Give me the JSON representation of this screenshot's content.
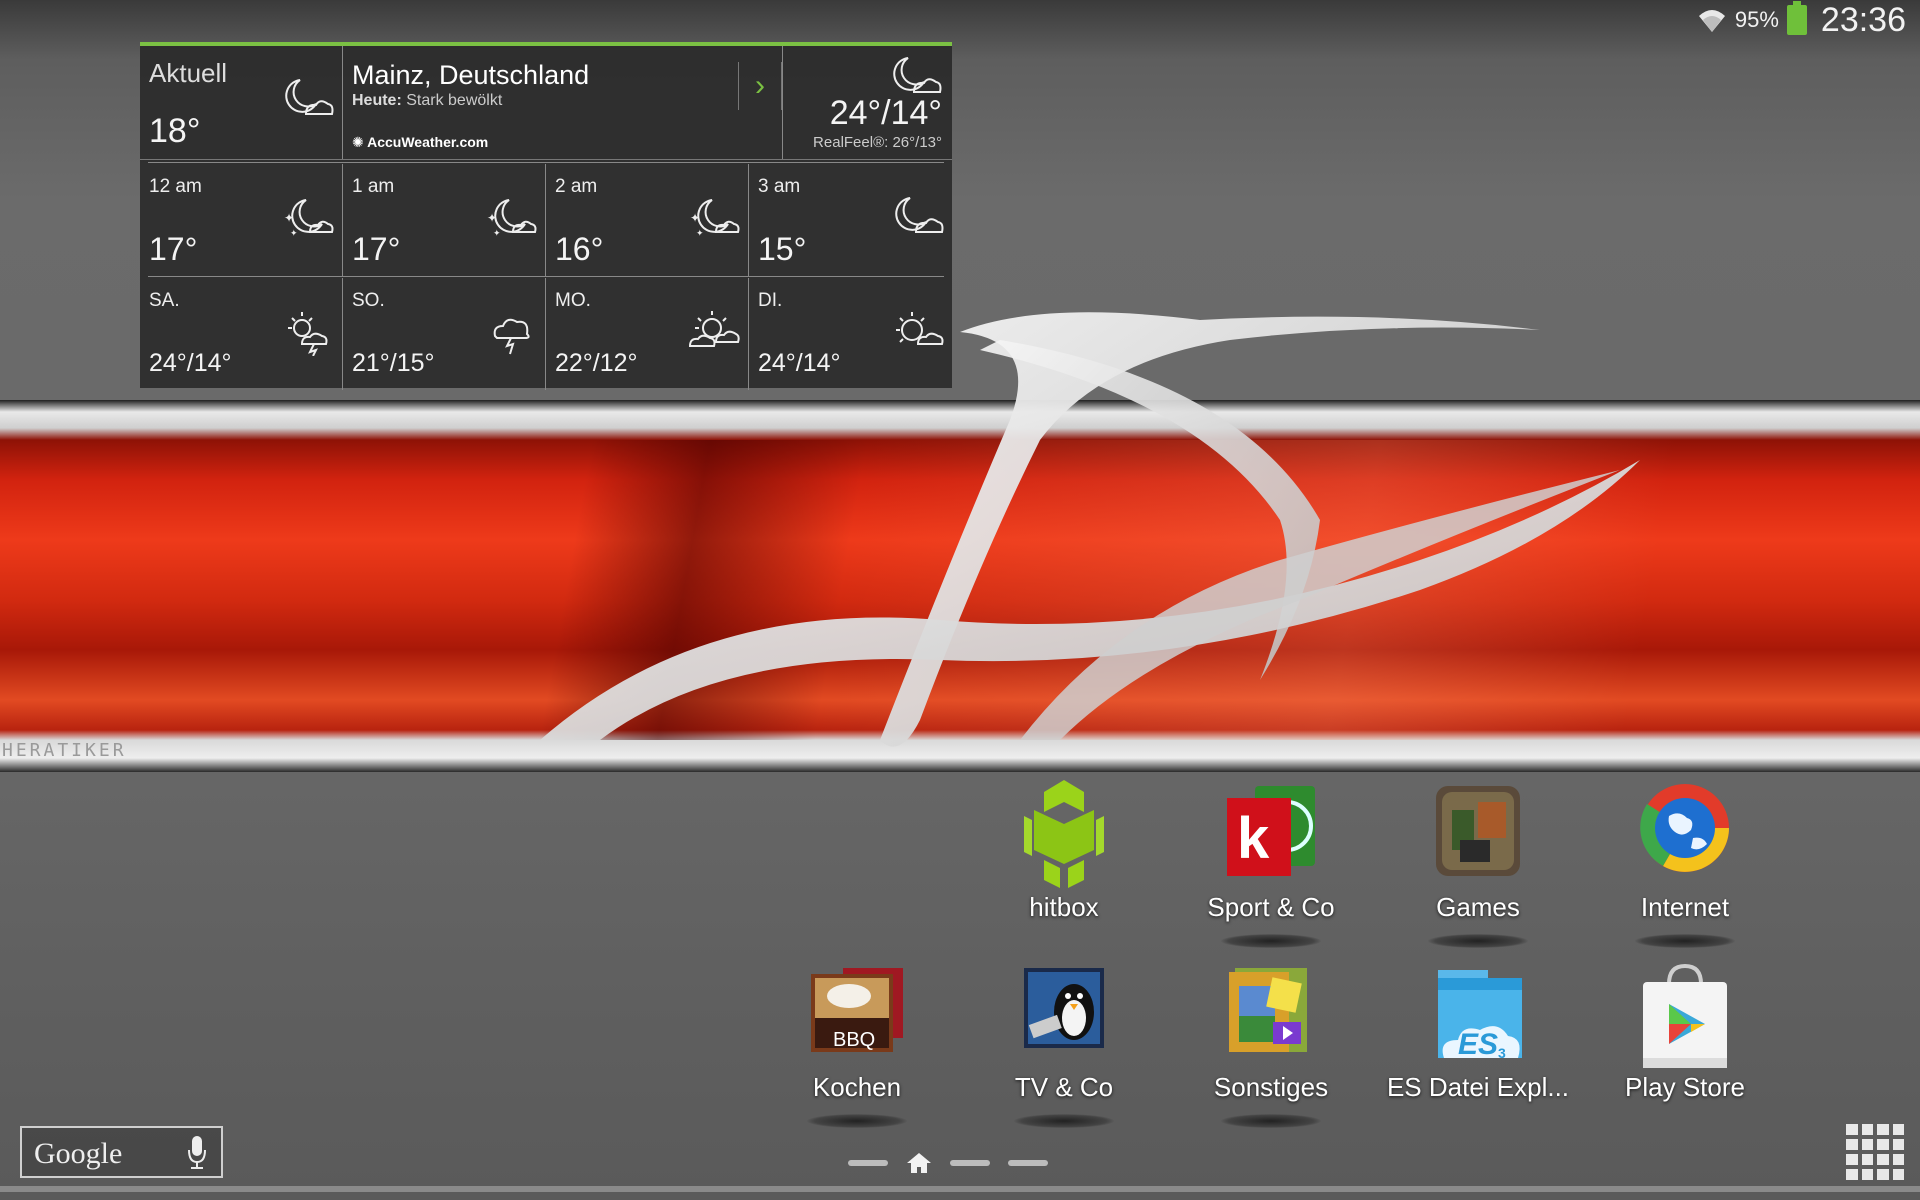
{
  "status_bar": {
    "battery_percent": "95%",
    "time": "23:36",
    "icons": [
      "wifi-icon",
      "battery-icon"
    ]
  },
  "weather": {
    "current": {
      "label": "Aktuell",
      "temp": "18°",
      "icon": "moon-cloud-icon"
    },
    "location": {
      "city": "Mainz, Deutschland",
      "today_label": "Heute:",
      "today_text": "Stark bewölkt",
      "provider": "AccuWeather.com"
    },
    "today_hilo": {
      "hilo": "24°/14°",
      "realfeel": "RealFeel®: 26°/13°",
      "icon": "moon-cloud-icon"
    },
    "hourly": [
      {
        "time": "12 am",
        "temp": "17°",
        "icon": "moon-stars-icon"
      },
      {
        "time": "1 am",
        "temp": "17°",
        "icon": "moon-stars-icon"
      },
      {
        "time": "2 am",
        "temp": "16°",
        "icon": "moon-stars-icon"
      },
      {
        "time": "3 am",
        "temp": "15°",
        "icon": "moon-cloud-icon"
      }
    ],
    "daily": [
      {
        "day": "SA.",
        "temps": "24°/14°",
        "icon": "sun-storm-icon"
      },
      {
        "day": "SO.",
        "temps": "21°/15°",
        "icon": "cloud-lightning-icon"
      },
      {
        "day": "MO.",
        "temps": "22°/12°",
        "icon": "sun-cloud-icon"
      },
      {
        "day": "DI.",
        "temps": "24°/14°",
        "icon": "sun-cloud-icon"
      }
    ]
  },
  "wallpaper": {
    "tag": "HERATIKER",
    "accent": "#d2230f"
  },
  "apps": {
    "row1": [
      {
        "label": "hitbox",
        "icon": "android-icon"
      },
      {
        "label": "Sport & Co",
        "icon": "sport-folder-icon"
      },
      {
        "label": "Games",
        "icon": "games-folder-icon"
      },
      {
        "label": "Internet",
        "icon": "internet-folder-icon"
      }
    ],
    "row2": [
      {
        "label": "Kochen",
        "icon": "cooking-folder-icon"
      },
      {
        "label": "TV & Co",
        "icon": "tv-folder-icon"
      },
      {
        "label": "Sonstiges",
        "icon": "misc-folder-icon"
      },
      {
        "label": "ES Datei Expl...",
        "icon": "es-file-explorer-icon"
      },
      {
        "label": "Play Store",
        "icon": "play-store-icon"
      }
    ]
  },
  "google_search": {
    "label": "Google",
    "icon": "mic-icon"
  },
  "colors": {
    "weather_accent": "#7bc143",
    "battery": "#6fc03a"
  }
}
